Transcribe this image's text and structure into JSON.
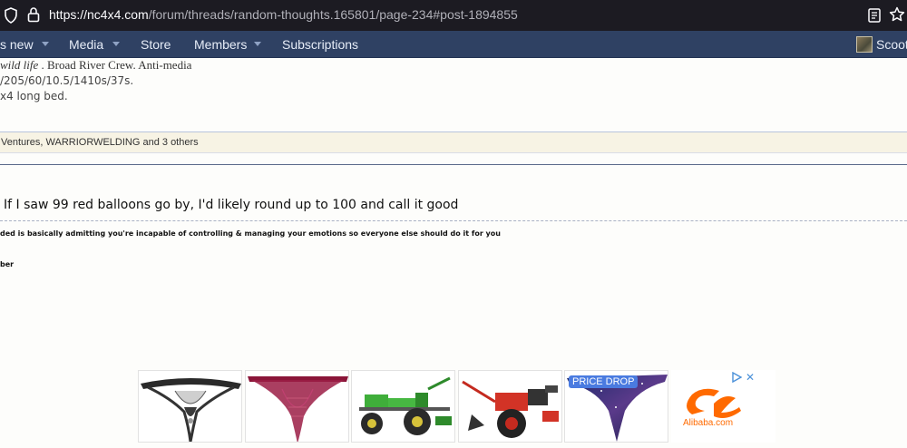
{
  "browser": {
    "url_host": "https://nc4x4.com",
    "url_path": "/forum/threads/random-thoughts.165801/page-234#post-1894855",
    "icons": [
      "shield-icon",
      "lock-icon",
      "reader-view-icon",
      "bookmark-star-icon"
    ]
  },
  "nav": {
    "items": [
      {
        "label": "s new",
        "has_caret": true
      },
      {
        "label": "Media",
        "has_caret": true
      },
      {
        "label": "Store",
        "has_caret": false
      },
      {
        "label": "Members",
        "has_caret": true
      },
      {
        "label": "Subscriptions",
        "has_caret": false
      }
    ],
    "username": "Scoot"
  },
  "signature": {
    "line1_italic": "wild life",
    "line1_rest": " . Broad River Crew. Anti-media",
    "line2": "/205/60/10.5/1410s/37s.",
    "line3": "x4 long bed."
  },
  "reactions": {
    "text": "Ventures, WARRIORWELDING and 3 others"
  },
  "post": {
    "text": "If I saw 99 red balloons go by, I'd likely round up to 100 and call it good",
    "signature_quote": "ded is basically admitting you're incapable of controlling & managing your emotions so everyone else should do it for you",
    "member_label": "ber"
  },
  "ads": {
    "price_drop_label": "PRICE DROP",
    "brand": "Alibaba.com",
    "close_label": "✕",
    "items": [
      "lingerie-ad",
      "lingerie-ad",
      "walking-tractor-ad",
      "walking-tractor-ad",
      "lingerie-ad",
      "alibaba-ad"
    ]
  },
  "colors": {
    "nav_bg": "#2f4163",
    "browser_bg": "#1c1b22",
    "alibaba_orange": "#ff6a00",
    "price_drop_blue": "#4a7be0"
  }
}
